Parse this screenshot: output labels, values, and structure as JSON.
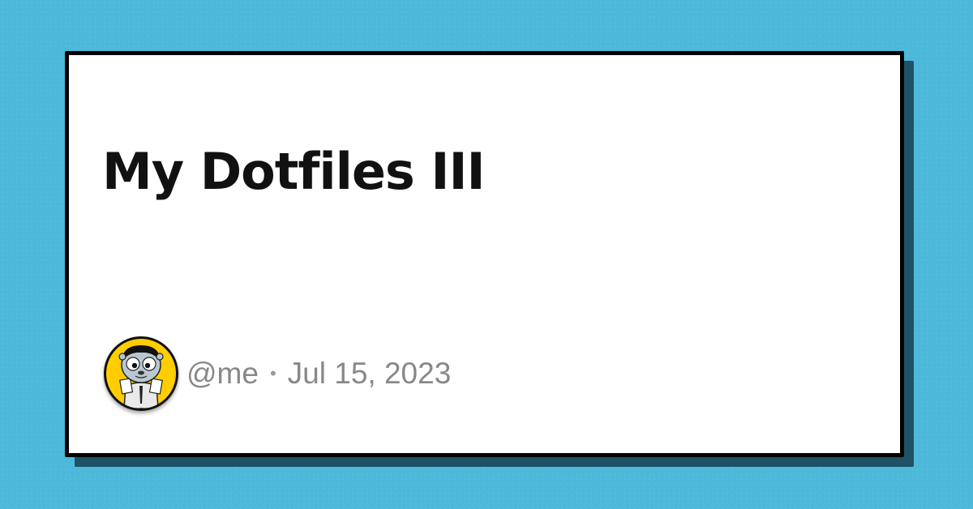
{
  "post": {
    "title": "My Dotfiles III",
    "author": "@me",
    "separator": "•",
    "date": "Jul 15, 2023"
  },
  "avatar": {
    "icon": "gopher-avatar-icon",
    "background": "#ffcd00"
  },
  "colors": {
    "background": "#4db9da",
    "card": "#ffffff",
    "card_border": "#000000",
    "card_shadow": "#1f5266",
    "title_text": "#111111",
    "meta_text": "#888888"
  }
}
